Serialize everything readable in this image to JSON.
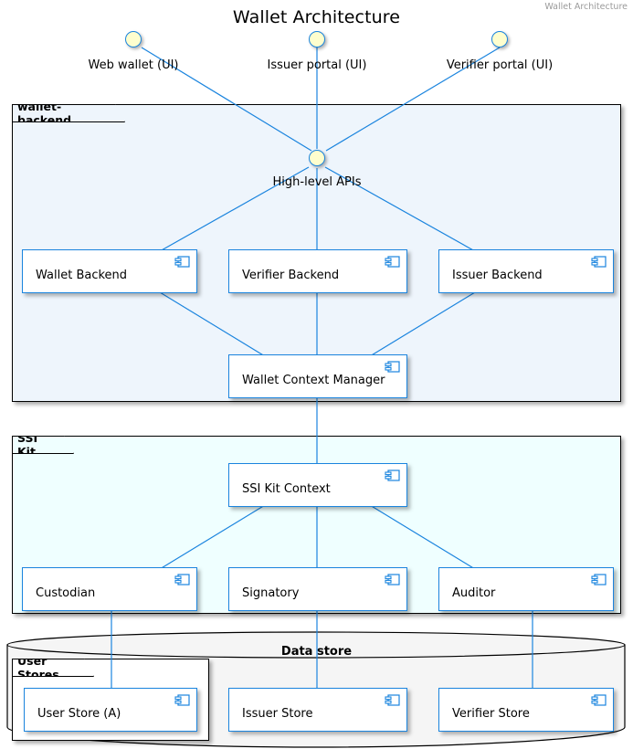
{
  "diagram": {
    "title": "Wallet Architecture",
    "watermark": "Wallet Architecture",
    "type": "uml-component-diagram"
  },
  "colors": {
    "component_border": "#1A84DE",
    "component_fill": "#FFFFFF",
    "interface_fill": "#FEFECE",
    "package_border": "#000000",
    "wallet_backend_fill": "#EEF5FC",
    "ssi_kit_fill": "#EFFFFF",
    "database_fill": "#F5F5F5",
    "user_stores_fill": "#FFFFFF",
    "edge_color": "#1A84DE",
    "watermark_color": "#9A9A9A"
  },
  "interfaces": [
    {
      "id": "web-wallet-ui",
      "label": "Web wallet (UI)"
    },
    {
      "id": "issuer-portal-ui",
      "label": "Issuer portal (UI)"
    },
    {
      "id": "verifier-portal-ui",
      "label": "Verifier portal (UI)"
    },
    {
      "id": "high-level-apis",
      "label": "High-level APIs"
    }
  ],
  "packages": [
    {
      "id": "wallet-backend",
      "label": "wallet-backend"
    },
    {
      "id": "ssi-kit",
      "label": "SSI Kit"
    },
    {
      "id": "user-stores",
      "label": "User Stores"
    }
  ],
  "database": {
    "id": "data-store",
    "label": "Data store"
  },
  "components": [
    {
      "id": "wallet-backend-component",
      "label": "Wallet Backend",
      "package": "wallet-backend"
    },
    {
      "id": "verifier-backend-component",
      "label": "Verifier Backend",
      "package": "wallet-backend"
    },
    {
      "id": "issuer-backend-component",
      "label": "Issuer Backend",
      "package": "wallet-backend"
    },
    {
      "id": "wallet-context-manager",
      "label": "Wallet Context Manager",
      "package": "wallet-backend"
    },
    {
      "id": "ssi-kit-context",
      "label": "SSI Kit Context",
      "package": "ssi-kit"
    },
    {
      "id": "custodian",
      "label": "Custodian",
      "package": "ssi-kit"
    },
    {
      "id": "signatory",
      "label": "Signatory",
      "package": "ssi-kit"
    },
    {
      "id": "auditor",
      "label": "Auditor",
      "package": "ssi-kit"
    },
    {
      "id": "user-store-a",
      "label": "User Store (A)",
      "package": "user-stores"
    },
    {
      "id": "issuer-store",
      "label": "Issuer Store",
      "package": "data-store"
    },
    {
      "id": "verifier-store",
      "label": "Verifier Store",
      "package": "data-store"
    }
  ],
  "connections": [
    {
      "from": "web-wallet-ui",
      "to": "high-level-apis"
    },
    {
      "from": "issuer-portal-ui",
      "to": "high-level-apis"
    },
    {
      "from": "verifier-portal-ui",
      "to": "high-level-apis"
    },
    {
      "from": "high-level-apis",
      "to": "wallet-backend-component"
    },
    {
      "from": "high-level-apis",
      "to": "verifier-backend-component"
    },
    {
      "from": "high-level-apis",
      "to": "issuer-backend-component"
    },
    {
      "from": "wallet-backend-component",
      "to": "wallet-context-manager"
    },
    {
      "from": "verifier-backend-component",
      "to": "wallet-context-manager"
    },
    {
      "from": "issuer-backend-component",
      "to": "wallet-context-manager"
    },
    {
      "from": "wallet-context-manager",
      "to": "ssi-kit-context"
    },
    {
      "from": "ssi-kit-context",
      "to": "custodian"
    },
    {
      "from": "ssi-kit-context",
      "to": "signatory"
    },
    {
      "from": "ssi-kit-context",
      "to": "auditor"
    },
    {
      "from": "custodian",
      "to": "user-store-a"
    },
    {
      "from": "signatory",
      "to": "issuer-store"
    },
    {
      "from": "auditor",
      "to": "verifier-store"
    }
  ]
}
